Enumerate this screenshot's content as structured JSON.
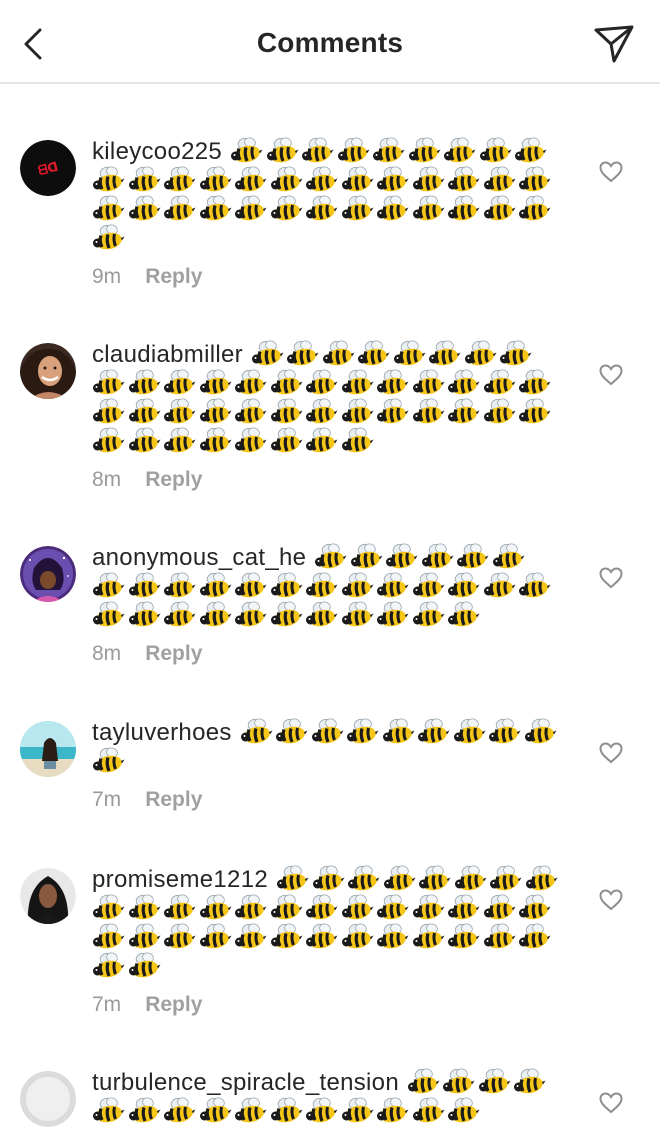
{
  "header": {
    "title": "Comments"
  },
  "comments": [
    {
      "username": "kileycoo225",
      "bees": 36,
      "time": "9m",
      "reply": "Reply",
      "avatar": "dark-logo"
    },
    {
      "username": "claudiabmiller",
      "bees": 42,
      "time": "8m",
      "reply": "Reply",
      "avatar": "woman-smiling"
    },
    {
      "username": "anonymous_cat_he",
      "bees": 30,
      "time": "8m",
      "reply": "Reply",
      "avatar": "cartoon-cat"
    },
    {
      "username": "tayluverhoes",
      "bees": 10,
      "time": "7m",
      "reply": "Reply",
      "avatar": "beach"
    },
    {
      "username": "promiseme1212",
      "bees": 36,
      "time": "7m",
      "reply": "Reply",
      "avatar": "woman-dark"
    },
    {
      "username": "turbulence_spiracle_tension",
      "bees": 15,
      "time": "",
      "reply": "",
      "avatar": "default-grey"
    }
  ]
}
